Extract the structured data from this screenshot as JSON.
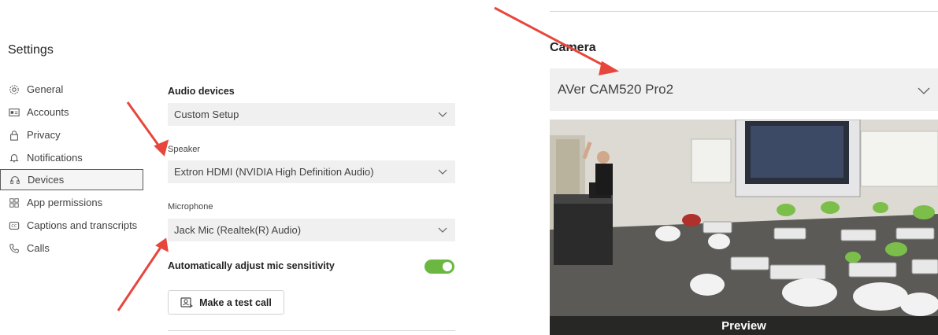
{
  "settings": {
    "title": "Settings",
    "nav": [
      {
        "label": "General",
        "icon": "gear-icon"
      },
      {
        "label": "Accounts",
        "icon": "id-card-icon"
      },
      {
        "label": "Privacy",
        "icon": "lock-icon"
      },
      {
        "label": "Notifications",
        "icon": "bell-icon"
      },
      {
        "label": "Devices",
        "icon": "headset-icon",
        "active": true
      },
      {
        "label": "App permissions",
        "icon": "apps-icon"
      },
      {
        "label": "Captions and transcripts",
        "icon": "cc-icon"
      },
      {
        "label": "Calls",
        "icon": "phone-icon"
      }
    ]
  },
  "devices": {
    "audio_devices_label": "Audio devices",
    "audio_devices_value": "Custom Setup",
    "speaker_label": "Speaker",
    "speaker_value": "Extron HDMI (NVIDIA High Definition Audio)",
    "microphone_label": "Microphone",
    "microphone_value": "Jack Mic (Realtek(R) Audio)",
    "auto_adjust_label": "Automatically adjust mic sensitivity",
    "auto_adjust_on": true,
    "test_call_label": "Make a test call"
  },
  "camera": {
    "label": "Camera",
    "value": "AVer CAM520 Pro2",
    "preview_label": "Preview"
  },
  "colors": {
    "toggle_on": "#6bb742",
    "annotation_arrow": "#e8463c",
    "dropdown_bg": "#f0f0f0"
  }
}
